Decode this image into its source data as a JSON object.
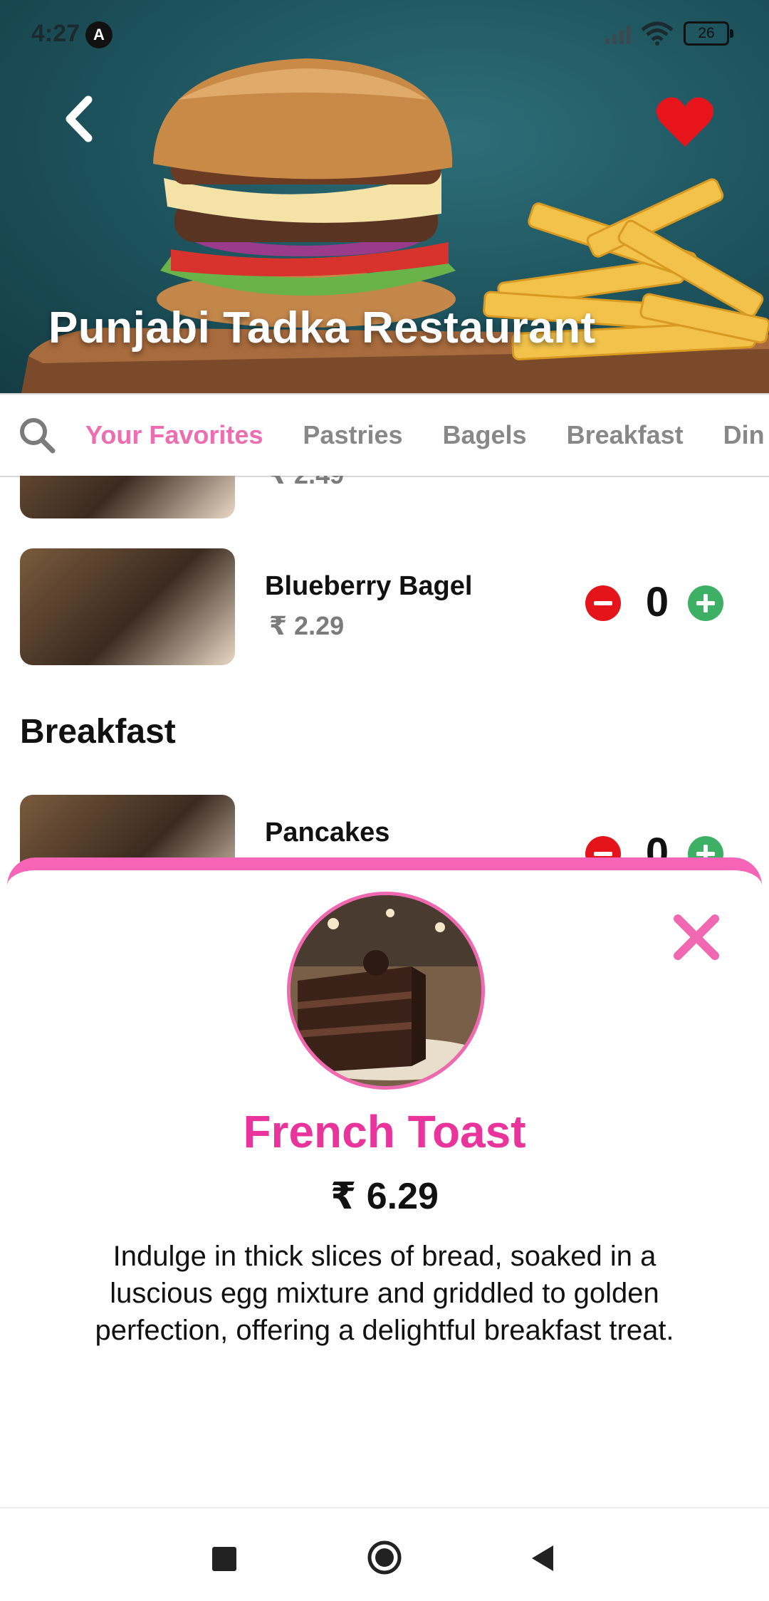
{
  "status_bar": {
    "time": "4:27",
    "notification_letter": "A",
    "battery": "26"
  },
  "hero": {
    "restaurant_name": "Punjabi Tadka Restaurant"
  },
  "tabs": [
    {
      "label": "Your Favorites",
      "active": true
    },
    {
      "label": "Pastries",
      "active": false
    },
    {
      "label": "Bagels",
      "active": false
    },
    {
      "label": "Breakfast",
      "active": false
    },
    {
      "label": "Din",
      "active": false
    }
  ],
  "list": {
    "partial_item_price": "₹ 2.49",
    "items": [
      {
        "name": "Blueberry Bagel",
        "price": "₹ 2.29",
        "quantity": "0"
      },
      {
        "name": "Pancakes",
        "price": "",
        "quantity": "0"
      }
    ],
    "section_title": "Breakfast"
  },
  "detail": {
    "name": "French Toast",
    "price": "₹ 6.29",
    "description": "Indulge in thick slices of bread, soaked in a luscious egg mixture and griddled to golden perfection, offering a delightful breakfast treat."
  },
  "colors": {
    "accent_pink": "#ee6cb0",
    "title_pink": "#e8349b",
    "sheet_border": "#f564b6",
    "minus_red": "#e5141b",
    "plus_green": "#3db066",
    "favorite_red": "#e8141b"
  },
  "icons": {
    "back": "chevron-left-icon",
    "favorite": "heart-icon",
    "search": "search-icon",
    "close": "close-icon",
    "minus": "minus-circle-icon",
    "plus": "plus-circle-icon"
  }
}
